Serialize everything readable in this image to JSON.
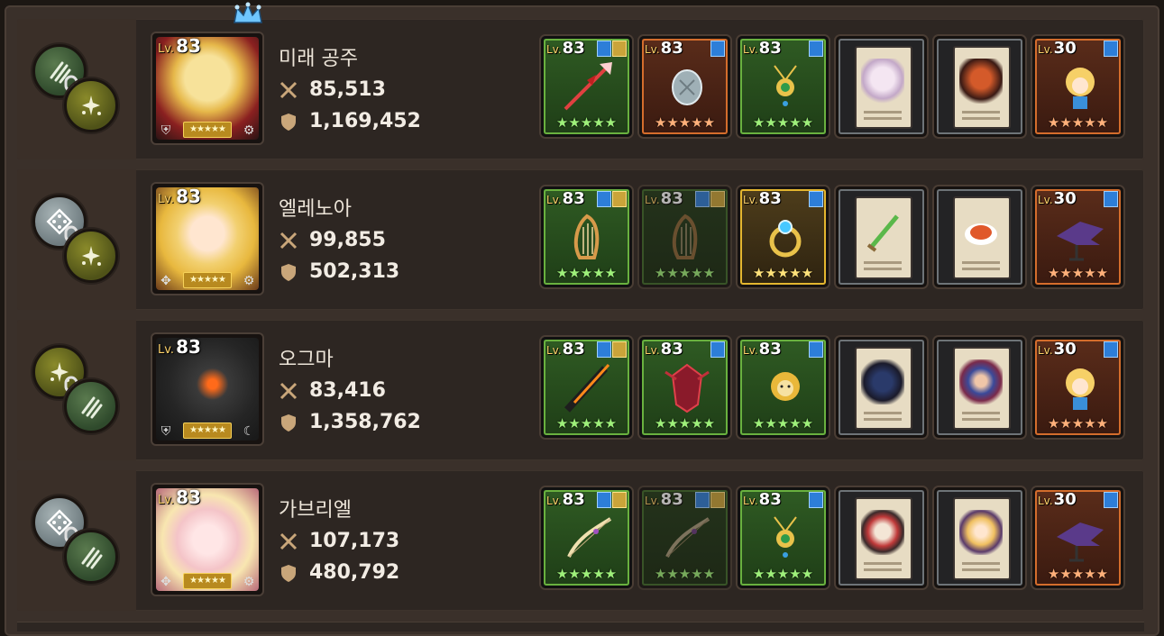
{
  "colors": {
    "panel_bg": "#2d2622",
    "equip_green": "#69b13f",
    "equip_orange": "#d46d2c",
    "equip_gold": "#e4b62f",
    "card_gray": "#6e7478",
    "stars_yellow": "#f6d25a"
  },
  "heroes": [
    {
      "name": "미래 공주",
      "level_prefix": "Lv.",
      "level": "83",
      "attack": "85,513",
      "hp": "1,169,452",
      "portrait_stars": "★★★★★",
      "has_crown": true,
      "badges": [
        "claw-icon",
        "star-burst-icon"
      ],
      "equipment": [
        {
          "kind": "weapon",
          "frame": "green",
          "level_prefix": "Lv.",
          "level": "83",
          "stars": "★★★★★",
          "icon": "red-spear-icon"
        },
        {
          "kind": "shield",
          "frame": "orange",
          "level_prefix": "Lv.",
          "level": "83",
          "stars": "★★★★★",
          "icon": "stone-shield-icon"
        },
        {
          "kind": "accessory",
          "frame": "green",
          "level_prefix": "Lv.",
          "level": "83",
          "stars": "★★★★★",
          "icon": "gold-amulet-icon"
        },
        {
          "kind": "card",
          "frame": "card",
          "icon": "white-beast-card-icon"
        },
        {
          "kind": "card",
          "frame": "card",
          "icon": "fire-knight-card-icon"
        },
        {
          "kind": "costume",
          "frame": "orange",
          "level_prefix": "Lv.",
          "level": "30",
          "stars": "★★★★★",
          "icon": "princess-figure-icon"
        }
      ]
    },
    {
      "name": "엘레노아",
      "level_prefix": "Lv.",
      "level": "83",
      "attack": "99,855",
      "hp": "502,313",
      "portrait_stars": "★★★★★",
      "has_crown": false,
      "badges": [
        "dice-icon",
        "star-burst-icon"
      ],
      "equipment": [
        {
          "kind": "weapon",
          "frame": "green",
          "level_prefix": "Lv.",
          "level": "83",
          "stars": "★★★★★",
          "icon": "harp-icon"
        },
        {
          "kind": "weapon",
          "frame": "dim",
          "level_prefix": "Lv.",
          "level": "83",
          "stars": "★★★★★",
          "icon": "harp-icon"
        },
        {
          "kind": "accessory",
          "frame": "gold",
          "level_prefix": "Lv.",
          "level": "83",
          "stars": "★★★★★",
          "icon": "blue-ring-icon"
        },
        {
          "kind": "card",
          "frame": "card",
          "icon": "green-sword-card-icon"
        },
        {
          "kind": "card",
          "frame": "card",
          "icon": "food-plate-card-icon"
        },
        {
          "kind": "costume",
          "frame": "orange",
          "level_prefix": "Lv.",
          "level": "30",
          "stars": "★★★★★",
          "icon": "dark-wing-figure-icon"
        }
      ]
    },
    {
      "name": "오그마",
      "level_prefix": "Lv.",
      "level": "83",
      "attack": "83,416",
      "hp": "1,358,762",
      "portrait_stars": "★★★★★",
      "has_crown": false,
      "badges": [
        "star-burst-icon",
        "claw-icon"
      ],
      "equipment": [
        {
          "kind": "weapon",
          "frame": "green",
          "level_prefix": "Lv.",
          "level": "83",
          "stars": "★★★★★",
          "icon": "flame-sword-icon"
        },
        {
          "kind": "shield",
          "frame": "green",
          "level_prefix": "Lv.",
          "level": "83",
          "stars": "★★★★★",
          "icon": "crimson-armor-icon"
        },
        {
          "kind": "accessory",
          "frame": "green",
          "level_prefix": "Lv.",
          "level": "83",
          "stars": "★★★★★",
          "icon": "lion-charm-icon"
        },
        {
          "kind": "card",
          "frame": "card",
          "icon": "demon-lord-card-icon"
        },
        {
          "kind": "card",
          "frame": "card",
          "icon": "blue-hair-card-icon"
        },
        {
          "kind": "costume",
          "frame": "orange",
          "level_prefix": "Lv.",
          "level": "30",
          "stars": "★★★★★",
          "icon": "princess-figure-icon"
        }
      ]
    },
    {
      "name": "가브리엘",
      "level_prefix": "Lv.",
      "level": "83",
      "attack": "107,173",
      "hp": "480,792",
      "portrait_stars": "★★★★★",
      "has_crown": false,
      "badges": [
        "dice-icon",
        "claw-icon"
      ],
      "equipment": [
        {
          "kind": "weapon",
          "frame": "green",
          "level_prefix": "Lv.",
          "level": "83",
          "stars": "★★★★★",
          "icon": "angel-bow-icon"
        },
        {
          "kind": "weapon",
          "frame": "dim",
          "level_prefix": "Lv.",
          "level": "83",
          "stars": "★★★★★",
          "icon": "angel-bow-icon"
        },
        {
          "kind": "accessory",
          "frame": "green",
          "level_prefix": "Lv.",
          "level": "83",
          "stars": "★★★★★",
          "icon": "gold-amulet-icon"
        },
        {
          "kind": "card",
          "frame": "card",
          "icon": "fox-mask-card-icon"
        },
        {
          "kind": "card",
          "frame": "card",
          "icon": "blonde-lady-card-icon"
        },
        {
          "kind": "costume",
          "frame": "orange",
          "level_prefix": "Lv.",
          "level": "30",
          "stars": "★★★★★",
          "icon": "dark-wing-figure-icon"
        }
      ]
    }
  ]
}
